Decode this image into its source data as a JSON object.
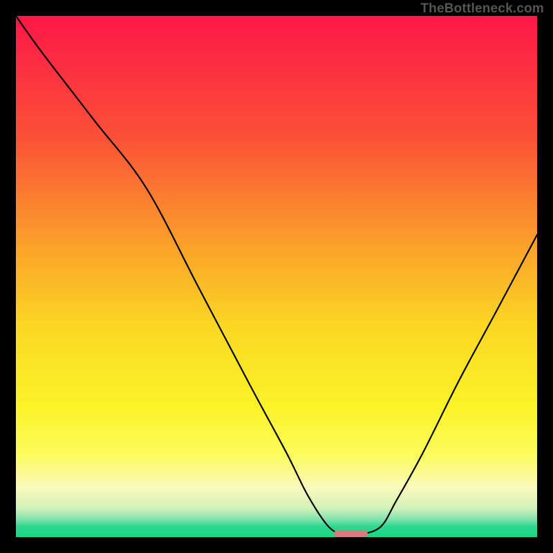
{
  "watermark": "TheBottleneck.com",
  "chart_data": {
    "type": "line",
    "title": "",
    "xlabel": "",
    "ylabel": "",
    "xlim": [
      0,
      100
    ],
    "ylim": [
      0,
      100
    ],
    "grid": false,
    "legend": false,
    "gradient_stops": [
      {
        "pos": 0.0,
        "color": "#fd1748"
      },
      {
        "pos": 0.23,
        "color": "#fb5037"
      },
      {
        "pos": 0.46,
        "color": "#fba829"
      },
      {
        "pos": 0.6,
        "color": "#fbd823"
      },
      {
        "pos": 0.75,
        "color": "#fbf328"
      },
      {
        "pos": 0.84,
        "color": "#fdfb5a"
      },
      {
        "pos": 0.905,
        "color": "#faf9bc"
      },
      {
        "pos": 0.945,
        "color": "#d0f2b9"
      },
      {
        "pos": 0.965,
        "color": "#86e3af"
      },
      {
        "pos": 0.98,
        "color": "#2dd68e"
      },
      {
        "pos": 1.0,
        "color": "#19d884"
      }
    ],
    "series": [
      {
        "name": "bottleneck-curve",
        "x": [
          0,
          5,
          15,
          25,
          35,
          45,
          52,
          56,
          60,
          63,
          66,
          70,
          73,
          78,
          85,
          92,
          100
        ],
        "y": [
          100,
          93,
          80,
          67,
          48,
          29,
          16,
          8,
          2,
          0.5,
          0.5,
          2,
          7,
          16,
          30,
          43,
          58
        ]
      }
    ],
    "marker": {
      "name": "optimal-zone",
      "x_start": 61,
      "x_end": 67.5,
      "y": 0,
      "height_pct": 1.3,
      "color": "#d87a7d"
    }
  }
}
